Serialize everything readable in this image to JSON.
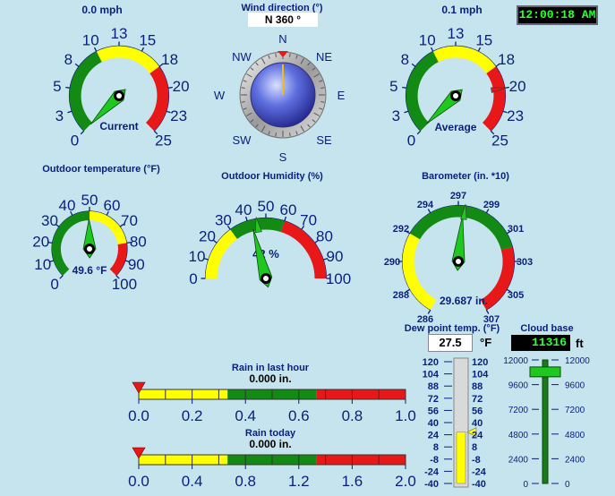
{
  "clock": "12:00:18 AM",
  "wind_speed_current": {
    "title": "0.0 mph",
    "label": "Current",
    "ticks": [
      "0",
      "3",
      "5",
      "8",
      "10",
      "13",
      "15",
      "18",
      "20",
      "23",
      "25"
    ],
    "value": 0.0,
    "min": 0,
    "max": 25
  },
  "wind_direction": {
    "title": "Wind direction (°)",
    "readout": "N  360 °",
    "value_deg": 360,
    "compass": {
      "n": "N",
      "ne": "NE",
      "e": "E",
      "se": "SE",
      "s": "S",
      "sw": "SW",
      "w": "W",
      "nw": "NW"
    }
  },
  "wind_speed_average": {
    "title": "0.1 mph",
    "label": "Average",
    "ticks": [
      "0",
      "3",
      "5",
      "8",
      "10",
      "13",
      "15",
      "18",
      "20",
      "23",
      "25"
    ],
    "value": 0.1,
    "max_marker": 20,
    "min": 0,
    "max": 25
  },
  "outdoor_temperature": {
    "title": "Outdoor temperature (°F)",
    "readout": "49.6 °F",
    "ticks": [
      "0",
      "10",
      "20",
      "30",
      "40",
      "50",
      "60",
      "70",
      "80",
      "90",
      "100"
    ],
    "value": 49.6,
    "min": 0,
    "max": 100
  },
  "outdoor_humidity": {
    "title": "Outdoor Humidity (%)",
    "readout": "42 %",
    "ticks": [
      "0",
      "10",
      "20",
      "30",
      "40",
      "50",
      "60",
      "70",
      "80",
      "90",
      "100"
    ],
    "value": 42,
    "marker": 45,
    "min": 0,
    "max": 100
  },
  "barometer": {
    "title": "Barometer (in. *10)",
    "readout": "29.687 in.",
    "ticks": [
      "286",
      "288",
      "290",
      "292",
      "294",
      "297",
      "299",
      "301",
      "303",
      "305",
      "307"
    ],
    "value": 296.87,
    "marker": 297,
    "min": 286,
    "max": 307
  },
  "rain_last_hour": {
    "title": "Rain in last hour",
    "readout": "0.000 in.",
    "ticks": [
      "0.0",
      "0.2",
      "0.4",
      "0.6",
      "0.8",
      "1.0"
    ],
    "value": 0.0
  },
  "rain_today": {
    "title": "Rain today",
    "readout": "0.000 in.",
    "ticks": [
      "0.0",
      "0.4",
      "0.8",
      "1.2",
      "1.6",
      "2.0"
    ],
    "value": 0.0
  },
  "dew_point": {
    "title": "Dew point temp. (°F)",
    "readout": "27.5",
    "unit": "°F",
    "ticks": [
      "120",
      "104",
      "88",
      "72",
      "56",
      "40",
      "24",
      "8",
      "-8",
      "-24",
      "-40"
    ],
    "value": 27.5,
    "min": -40,
    "max": 120
  },
  "cloud_base": {
    "title": "Cloud base",
    "readout": "11316",
    "unit": "ft",
    "ticks": [
      "12000",
      "9600",
      "7200",
      "4800",
      "2400",
      "0"
    ],
    "value": 11316,
    "min": 0,
    "max": 12000
  },
  "colors": {
    "background": "#c6e4ee",
    "text": "#0a1f7a",
    "green": "#138a13",
    "yellow": "#ffff00",
    "red": "#e81818",
    "needle": "#1ec81e"
  }
}
